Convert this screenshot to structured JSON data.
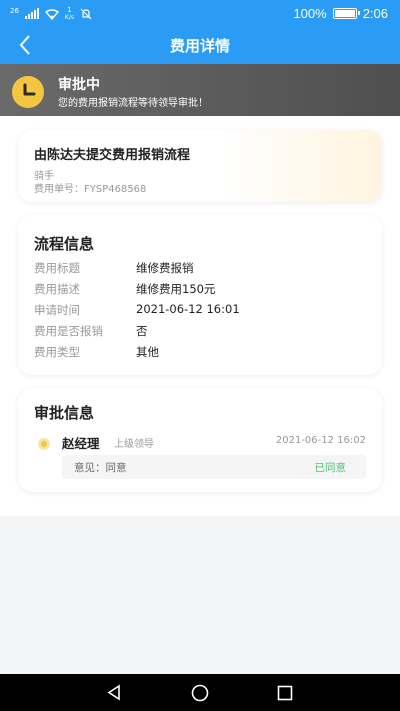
{
  "status_bar": {
    "network_small": "26",
    "speed_num": "1",
    "speed_unit": "K/s",
    "battery": "100%",
    "time": "2:06"
  },
  "nav": {
    "title": "费用详情",
    "back_icon": "chevron-left-icon"
  },
  "banner": {
    "title": "审批中",
    "subtitle": "您的费用报销流程等待领导审批！",
    "icon": "clock-icon",
    "icon_color": "#f4c542"
  },
  "flow_card": {
    "title": "由陈达夫提交费用报销流程",
    "role": "骑手",
    "expense_no": "费用单号：FYSP468568"
  },
  "process_info": {
    "heading": "流程信息",
    "rows": [
      {
        "label": "费用标题",
        "value": "维修费报销"
      },
      {
        "label": "费用描述",
        "value": "维修费用150元"
      },
      {
        "label": "申请时间",
        "value": "2021-06-12 16:01"
      },
      {
        "label": "费用是否报销",
        "value": "否"
      },
      {
        "label": "费用类型",
        "value": "其他"
      }
    ]
  },
  "approval_info": {
    "heading": "审批信息",
    "approver": "赵经理",
    "approver_role": "上级领导",
    "time": "2021-06-12 16:02",
    "opinion": "意见：同意",
    "status": "已同意",
    "status_color": "#4cc26f"
  },
  "colors": {
    "primary": "#2b9cf5",
    "banner": "#5a5a5a"
  }
}
